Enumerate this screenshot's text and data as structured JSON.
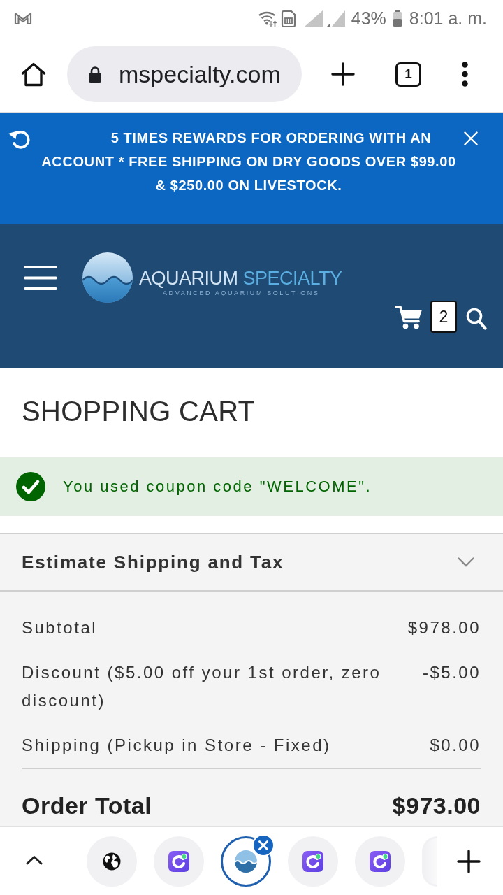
{
  "status_bar": {
    "battery": "43%",
    "time": "8:01 a. m."
  },
  "browser": {
    "url": "mspecialty.com",
    "tab_count": "1"
  },
  "promo_banner": {
    "text": "5 TIMES REWARDS FOR ORDERING WITH AN ACCOUNT * FREE SHIPPING ON DRY GOODS OVER $99.00 & $250.00 ON LIVESTOCK."
  },
  "header": {
    "logo": {
      "name": "AQUARIUM",
      "name_accent": "SPECIALTY",
      "tagline": "ADVANCED AQUARIUM SOLUTIONS"
    },
    "cart_count": "2"
  },
  "page_title": "SHOPPING CART",
  "message": {
    "text": "You used coupon code \"WELCOME\"."
  },
  "estimate": {
    "label": "Estimate Shipping and Tax",
    "expanded": false
  },
  "totals": [
    {
      "label": "Subtotal",
      "amount": "$978.00"
    },
    {
      "label": "Discount ($5.00 off your 1st order, zero discount)",
      "amount": "-$5.00"
    },
    {
      "label": "Shipping (Pickup in Store - Fixed)",
      "amount": "$0.00"
    }
  ],
  "order_total": {
    "label": "Order Total",
    "amount": "$973.00"
  },
  "tab_strip": {
    "tabs": [
      {
        "kind": "globe",
        "selected": false
      },
      {
        "kind": "app",
        "selected": false
      },
      {
        "kind": "site",
        "selected": true
      },
      {
        "kind": "app",
        "selected": false
      },
      {
        "kind": "app",
        "selected": false
      },
      {
        "kind": "blank",
        "selected": false
      }
    ]
  }
}
